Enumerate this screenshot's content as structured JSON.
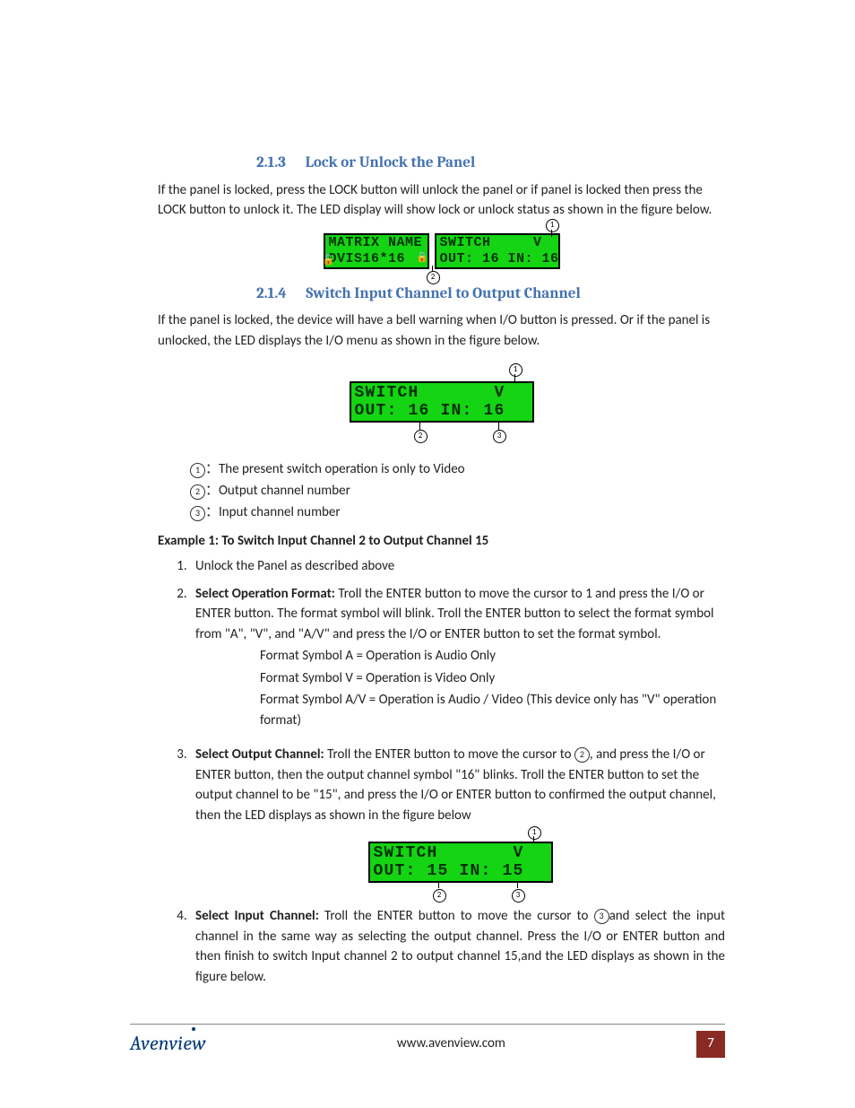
{
  "sections": {
    "s213": {
      "number": "2.1.3",
      "title": "Lock or Unlock the Panel",
      "para": "If the panel is locked, press the LOCK button will unlock the panel or if panel is locked then press the LOCK button to unlock it. The LED display will show lock or unlock status as shown in the figure below."
    },
    "s214": {
      "number": "2.1.4",
      "title": "Switch Input Channel to Output Channel",
      "para": "If the panel is locked, the device will have a bell warning when I/O button is pressed. Or if the panel is unlocked, the LED displays the I/O menu as shown in the figure below."
    }
  },
  "fig1": {
    "left_line1": "MATRIX NAME",
    "left_line2": "DVIS16*16",
    "right_line1": "SWITCH     V",
    "right_line2": "OUT: 16 IN: 16",
    "call1": "1",
    "call2": "2"
  },
  "fig2": {
    "line1": "SWITCH       V",
    "line2": "OUT: 16 IN: 16",
    "call1": "1",
    "call2": "2",
    "call3": "3"
  },
  "legend": {
    "l1_num": "1",
    "l1": "：The present switch operation is only to Video",
    "l2_num": "2",
    "l2": "：Output channel number",
    "l3_num": "3",
    "l3": "：Input channel number"
  },
  "example": {
    "title": "Example 1: To Switch Input Channel 2 to Output Channel 15",
    "step1": "Unlock the Panel as described above",
    "step2_label": "Select Operation Format:",
    "step2_body": " Troll the ENTER button to move the cursor to 1 and press the I/O or ENTER button. The format symbol will blink. Troll the ENTER button to select the format symbol from \"A\", \"V\", and \"A/V\" and press the I/O or ENTER button to set the format symbol.",
    "formats": {
      "a": "Format Symbol A = Operation is Audio Only",
      "v": "Format Symbol V = Operation is Video Only",
      "av": "Format Symbol A/V = Operation is Audio / Video (This device only has \"V\" operation format)"
    },
    "step3_label": "Select Output Channel:",
    "step3_pre": " Troll the ENTER button to move the cursor to ",
    "step3_circ": "2",
    "step3_post": ", and press the I/O or ENTER button, then the output channel symbol \"16\" blinks. Troll the ENTER button to set the output channel to be \"15\", and press the I/O or ENTER button to confirmed the output channel, then the LED displays as shown in the figure below",
    "step4_label": "Select Input Channel:",
    "step4_pre": " Troll the ENTER button to move the cursor to ",
    "step4_circ": "3",
    "step4_post": "and select the input channel in the same way as selecting the output channel. Press the I/O or ENTER button and then finish to switch Input channel 2 to output channel 15,and the LED displays as shown in the figure below."
  },
  "fig3": {
    "line1": "SWITCH       V",
    "line2": "OUT: 15 IN: 15",
    "call1": "1",
    "call2": "2",
    "call3": "3"
  },
  "footer": {
    "logo": "Avenview",
    "url": "www.avenview.com",
    "page": "7"
  }
}
